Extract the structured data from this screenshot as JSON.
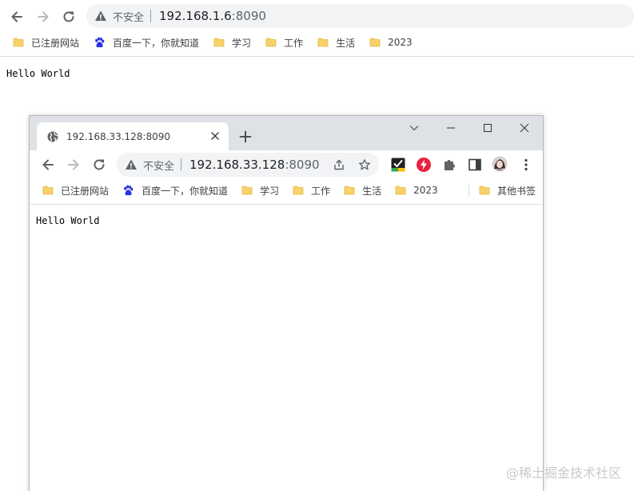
{
  "outer": {
    "url_host": "192.168.1.6",
    "url_port": ":8090",
    "security_label": "不安全",
    "bookmarks": [
      {
        "label": "已注册网站",
        "icon": "folder-icon"
      },
      {
        "label": "百度一下，你就知道",
        "icon": "baidu-paw-icon"
      },
      {
        "label": "学习",
        "icon": "folder-icon"
      },
      {
        "label": "工作",
        "icon": "folder-icon"
      },
      {
        "label": "生活",
        "icon": "folder-icon"
      },
      {
        "label": "2023",
        "icon": "folder-icon"
      }
    ],
    "page_text": "Hello World"
  },
  "inner": {
    "tab_title": "192.168.33.128:8090",
    "url_host": "192.168.33.128",
    "url_port": ":8090",
    "security_label": "不安全",
    "bookmarks": [
      {
        "label": "已注册网站",
        "icon": "folder-icon"
      },
      {
        "label": "百度一下，你就知道",
        "icon": "baidu-paw-icon"
      },
      {
        "label": "学习",
        "icon": "folder-icon"
      },
      {
        "label": "工作",
        "icon": "folder-icon"
      },
      {
        "label": "生活",
        "icon": "folder-icon"
      },
      {
        "label": "2023",
        "icon": "folder-icon"
      }
    ],
    "other_bookmarks": "其他书签",
    "page_text": "Hello World"
  },
  "watermark": "@稀土掘金技术社区",
  "colors": {
    "folder": "#f7d26a",
    "accent_red": "#e8223e",
    "omnibox_bg": "#f1f3f4",
    "titlebar_bg": "#dee1e6"
  }
}
